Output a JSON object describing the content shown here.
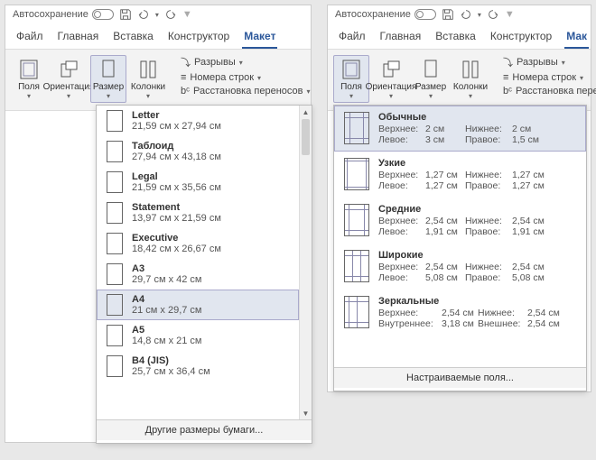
{
  "title": {
    "autosave": "Автосохранение"
  },
  "tabs": {
    "file": "Файл",
    "home": "Главная",
    "insert": "Вставка",
    "design": "Конструктор",
    "layout": "Макет",
    "layout_cut": "Мак"
  },
  "ribbon": {
    "margins": "Поля",
    "orientation": "Ориентация",
    "size": "Размер",
    "columns": "Колонки",
    "breaks": "Разрывы",
    "linenum": "Номера строк",
    "hyphen": "Расстановка переносов",
    "hyphen_cut": "Расстановка перенос"
  },
  "size_menu": {
    "items": [
      {
        "name": "Letter",
        "dim": "21,59 см x 27,94 см"
      },
      {
        "name": "Таблоид",
        "dim": "27,94 см x 43,18 см"
      },
      {
        "name": "Legal",
        "dim": "21,59 см x 35,56 см"
      },
      {
        "name": "Statement",
        "dim": "13,97 см x 21,59 см"
      },
      {
        "name": "Executive",
        "dim": "18,42 см x 26,67 см"
      },
      {
        "name": "A3",
        "dim": "29,7 см x 42 см"
      },
      {
        "name": "A4",
        "dim": "21 см x 29,7 см"
      },
      {
        "name": "A5",
        "dim": "14,8 см x 21 см"
      },
      {
        "name": "B4 (JIS)",
        "dim": "25,7 см x 36,4 см"
      }
    ],
    "more": "Другие размеры бумаги..."
  },
  "margin_menu": {
    "labels": {
      "top": "Верхнее:",
      "left": "Левое:",
      "bottom": "Нижнее:",
      "right": "Правое:",
      "inner": "Внутреннее:",
      "outer": "Внешнее:"
    },
    "items": [
      {
        "name": "Обычные",
        "top": "2 см",
        "left": "3 см",
        "bottom": "2 см",
        "right": "1,5 см"
      },
      {
        "name": "Узкие",
        "top": "1,27 см",
        "left": "1,27 см",
        "bottom": "1,27 см",
        "right": "1,27 см"
      },
      {
        "name": "Средние",
        "top": "2,54 см",
        "left": "1,91 см",
        "bottom": "2,54 см",
        "right": "1,91 см"
      },
      {
        "name": "Широкие",
        "top": "2,54 см",
        "left": "5,08 см",
        "bottom": "2,54 см",
        "right": "5,08 см"
      }
    ],
    "mirror": {
      "name": "Зеркальные",
      "top": "2,54 см",
      "inner": "3,18 см",
      "bottom": "2,54 см",
      "outer": "2,54 см"
    },
    "custom": "Настраиваемые поля..."
  }
}
